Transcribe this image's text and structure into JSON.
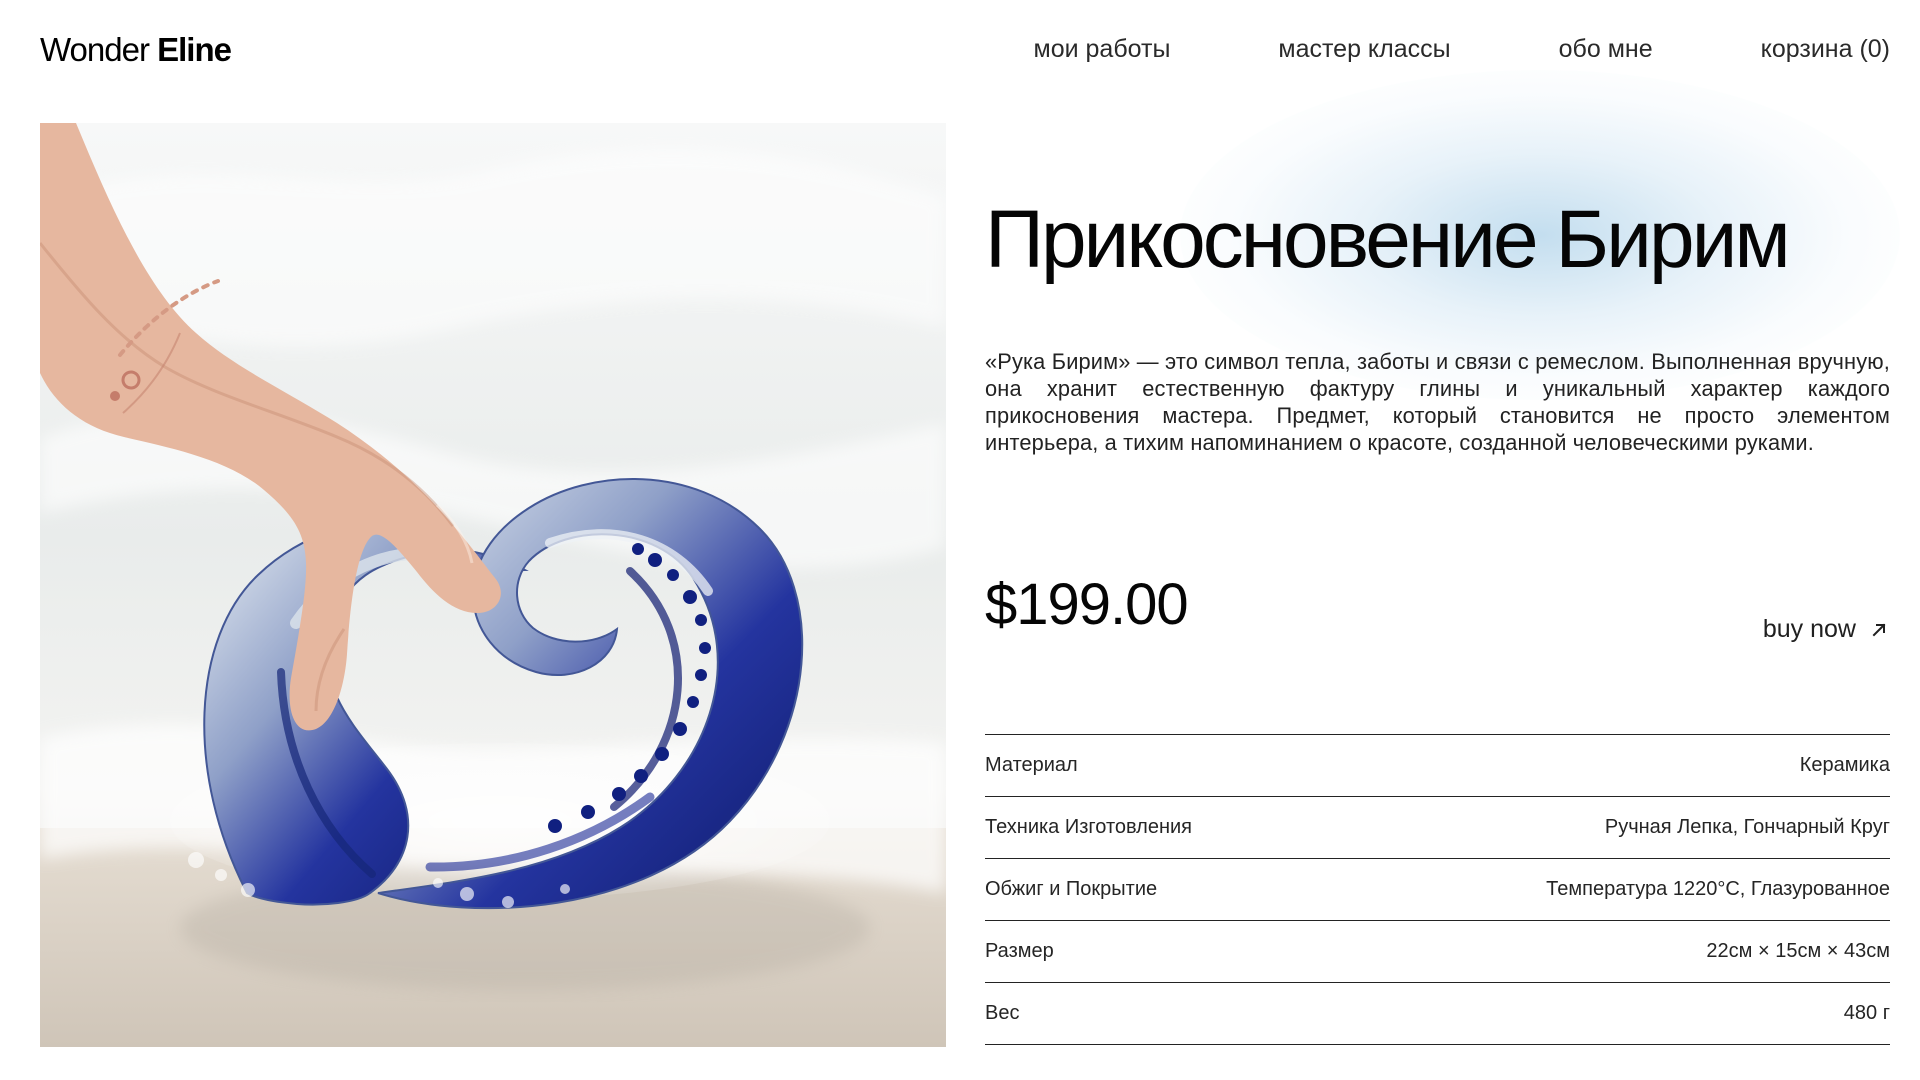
{
  "brand": {
    "light": "Wonder",
    "bold": "Eline"
  },
  "nav": {
    "items": [
      "мои работы",
      "мастер классы",
      "обо мне",
      "корзина (0)"
    ]
  },
  "product": {
    "title": "Прикосновение Бирим",
    "description": "«Рука Бирим» — это символ тепла, заботы и связи с ремеслом. Выполненная вручную, она хранит естественную фактуру глины и уникальный характер каждого прикосновения мастера. Предмет, который становится не просто элементом интерьера, а тихим напоминанием о красоте, созданной человеческими руками.",
    "price": "$199.00",
    "buy_label": "buy now",
    "specs": [
      {
        "label": "Материал",
        "value": "Керамика"
      },
      {
        "label": "Техника Изготовления",
        "value": "Ручная Лепка, Гончарный Круг"
      },
      {
        "label": "Обжиг и Покрытие",
        "value": "Температура 1220°C, Глазурованное"
      },
      {
        "label": "Размер",
        "value": "22см × 15см × 43см"
      },
      {
        "label": "Вес",
        "value": "480 г"
      }
    ]
  },
  "icons": {
    "buy": "arrow-up-right-icon"
  },
  "colors": {
    "text": "#050505",
    "muted_text": "#222222",
    "glow": "#cfe5f5",
    "ceramic_blue": "#1f2f9d",
    "sand": "#d9d1c6"
  }
}
